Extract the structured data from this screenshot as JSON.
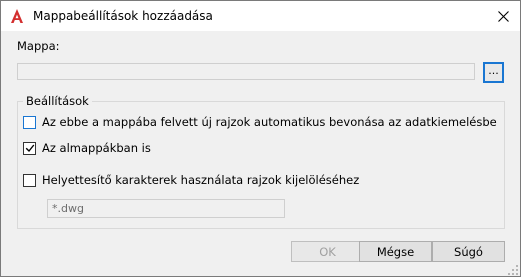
{
  "window": {
    "title": "Mappabeállítások hozzáadása",
    "close_icon": "close-icon",
    "app_icon": "autocad-icon"
  },
  "folder": {
    "label": "Mappa:",
    "path_value": "",
    "browse_label": "..."
  },
  "settings": {
    "group_label": "Beállítások",
    "options": [
      {
        "label": "Az ebbe a mappába felvett új rajzok automatikus bevonása az adatkiemelésbe",
        "checked": false
      },
      {
        "label": "Az almappákban is",
        "checked": true
      },
      {
        "label": "Helyettesítő karakterek használata rajzok kijelöléséhez",
        "checked": false
      }
    ],
    "pattern_value": "*.dwg"
  },
  "buttons": {
    "ok": "OK",
    "cancel": "Mégse",
    "help": "Súgó"
  },
  "colors": {
    "accent": "#1976d2",
    "app_icon": "#d32f2f"
  }
}
